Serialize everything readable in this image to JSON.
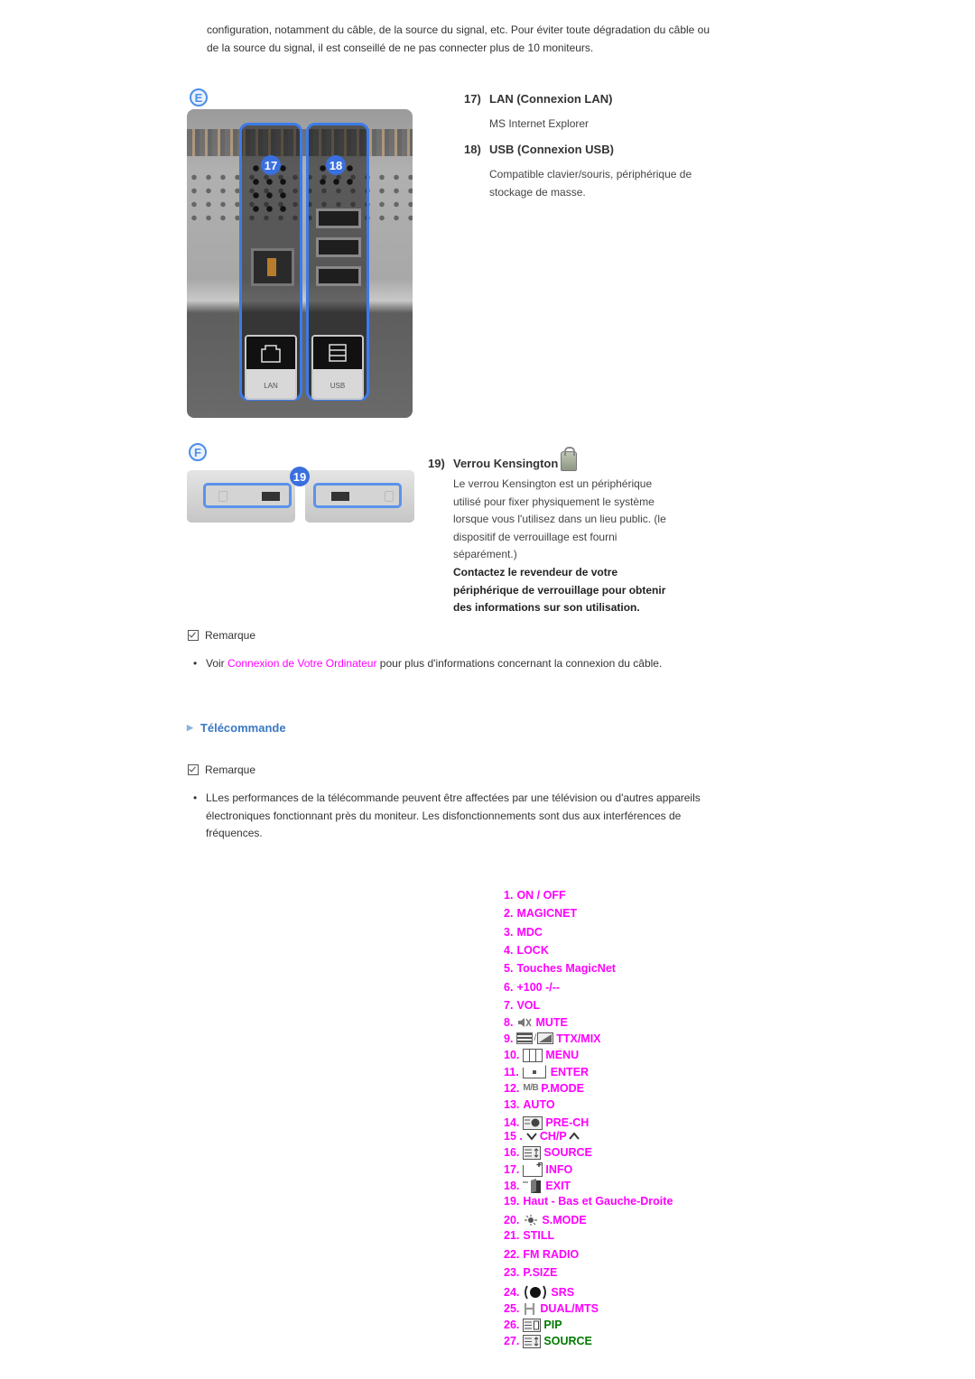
{
  "intro": {
    "line1": "configuration, notamment du câble, de la source du signal, etc. Pour éviter toute dégradation du câble ou",
    "line2": "de la source du signal, il est conseillé de ne pas connecter plus de 10 moniteurs."
  },
  "figure_e": {
    "letter": "E",
    "badges": [
      "17",
      "18"
    ],
    "port_labels": [
      "LAN",
      "USB"
    ]
  },
  "items_e": [
    {
      "num": "17)",
      "title": "LAN (Connexion LAN)",
      "desc": [
        "MS Internet Explorer"
      ]
    },
    {
      "num": "18)",
      "title": "USB (Connexion USB)",
      "desc": [
        "Compatible clavier/souris, périphérique de",
        "stockage de masse."
      ]
    }
  ],
  "figure_f": {
    "letter": "F",
    "badge": "19"
  },
  "item_f": {
    "num": "19)",
    "title": "Verrou Kensington",
    "icon": "kensington-lock-icon",
    "desc": [
      "Le verrou Kensington est un périphérique",
      "utilisé pour fixer physiquement le système",
      "lorsque vous l'utilisez dans un lieu public. (le",
      "dispositif de verrouillage est fourni",
      "séparément.)"
    ],
    "bold": [
      "Contactez le revendeur de votre",
      "périphérique de verrouillage pour obtenir",
      "des informations sur son utilisation."
    ]
  },
  "note1": {
    "label": "Remarque",
    "bullet_prefix": "Voir ",
    "link": "Connexion de Votre Ordinateur",
    "bullet_suffix": " pour plus d'informations concernant la connexion du câble."
  },
  "section": {
    "title": "Télécommande",
    "color": "#3a78c3"
  },
  "note2": {
    "label": "Remarque",
    "lines": [
      "LLes performances de la télécommande peuvent être affectées par une télévision ou d'autres appareils",
      "électroniques fonctionnant près du moniteur. Les disfonctionnements sont dus aux interférences de",
      "fréquences."
    ]
  },
  "remote": {
    "accent": "#ff00ff",
    "green": "#007a00",
    "items": [
      {
        "num": "1.",
        "label": "ON / OFF"
      },
      {
        "num": "2.",
        "label": "MAGICNET"
      },
      {
        "num": "3.",
        "label": "MDC"
      },
      {
        "num": "4.",
        "label": "LOCK"
      },
      {
        "num": "5.",
        "label": "Touches MagicNet"
      },
      {
        "num": "6.",
        "label": "+100 -/--"
      },
      {
        "num": "7.",
        "label": "VOL"
      },
      {
        "num": "8.",
        "label": "MUTE",
        "icon": "mute-icon"
      },
      {
        "num": "9.",
        "label": "TTX/MIX",
        "icon": "ttx-mix-icon"
      },
      {
        "num": "10.",
        "label": "MENU",
        "icon": "menu-icon"
      },
      {
        "num": "11.",
        "label": "ENTER",
        "icon": "enter-icon"
      },
      {
        "num": "12.",
        "label": "P.MODE",
        "icon": "mb-icon",
        "icon_text": "M/B"
      },
      {
        "num": "13.",
        "label": "AUTO"
      },
      {
        "num": "14.",
        "label": "PRE-CH",
        "icon": "pre-ch-icon"
      },
      {
        "num": "15 .",
        "label": "CH/P",
        "icon": "chevron-down-icon",
        "icon_after": "chevron-up-icon"
      },
      {
        "num": "16.",
        "label": "SOURCE",
        "icon": "source-icon"
      },
      {
        "num": "17.",
        "label": "INFO",
        "icon": "info-icon"
      },
      {
        "num": "18.",
        "label": "EXIT",
        "icon": "exit-icon"
      },
      {
        "num": "19.",
        "label": "Haut - Bas et Gauche-Droite"
      },
      {
        "num": "20.",
        "label": "S.MODE",
        "icon": "s-mode-icon"
      },
      {
        "num": "21.",
        "label": "STILL"
      },
      {
        "num": "22.",
        "label": "FM RADIO"
      },
      {
        "num": "23.",
        "label": "P.SIZE"
      },
      {
        "num": "24.",
        "label": "SRS",
        "icon": "srs-icon"
      },
      {
        "num": "25.",
        "label": "DUAL/MTS",
        "icon": "dual-mts-icon"
      },
      {
        "num": "26.",
        "label": "PIP",
        "icon": "pip-icon",
        "green": true
      },
      {
        "num": "27.",
        "label": "SOURCE",
        "icon": "source-icon",
        "green": true
      }
    ]
  }
}
